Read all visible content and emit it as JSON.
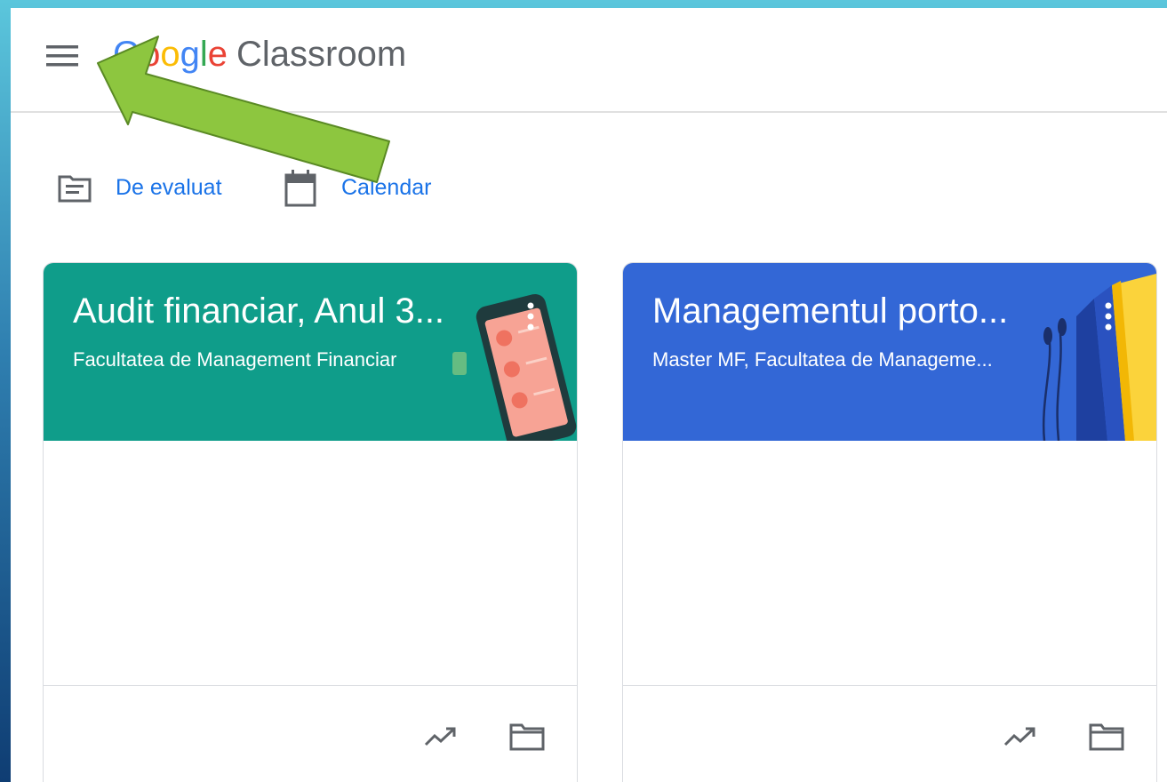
{
  "header": {
    "logo_brand": "Google",
    "logo_product": "Classroom"
  },
  "quick_links": [
    {
      "label": "De evaluat",
      "icon": "to-review-icon"
    },
    {
      "label": "Calendar",
      "icon": "calendar-icon"
    }
  ],
  "courses": [
    {
      "title": "Audit financiar, Anul 3...",
      "subtitle": "Facultatea de Management Financiar",
      "color": "#0f9d8a"
    },
    {
      "title": "Managementul porto...",
      "subtitle": "Master MF, Facultatea de Manageme...",
      "color": "#3367d6"
    }
  ],
  "colors": {
    "accent": "#1a73e8",
    "arrow": "#8dc63f"
  }
}
